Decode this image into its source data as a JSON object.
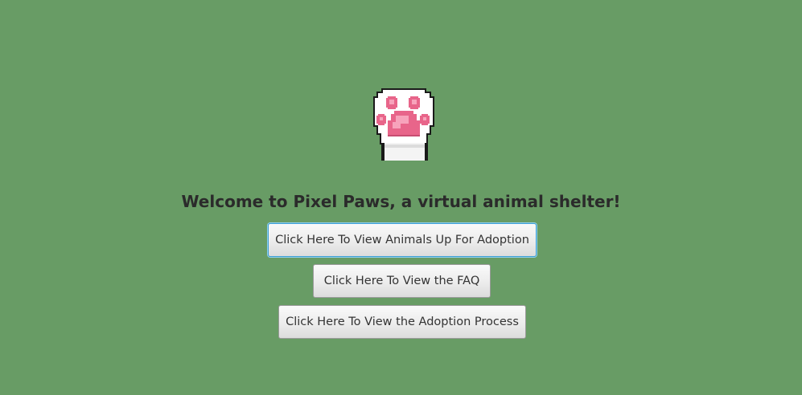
{
  "app": {
    "logo_icon": "cat-paw-icon",
    "welcome_text": "Welcome to Pixel Paws, a virtual animal shelter!"
  },
  "buttons": {
    "view_animals_label": "Click Here To View Animals Up For Adoption",
    "view_faq_label": "Click Here To View the FAQ",
    "view_process_label": "Click Here To View the Adoption Process"
  },
  "colors": {
    "background": "#689c65",
    "paw_pink": "#f07a9a",
    "focus_ring": "#3d9ed1"
  }
}
